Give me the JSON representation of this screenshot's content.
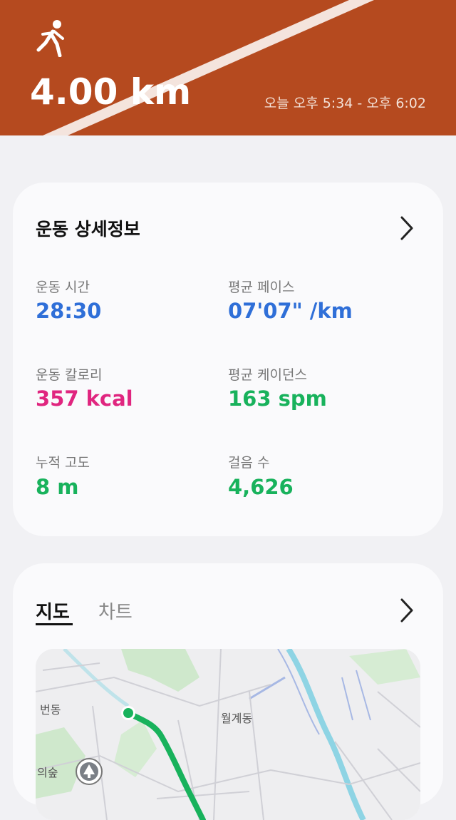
{
  "workout": {
    "distance": "4.00 km",
    "time_range": "오늘 오후 5:34 - 오후 6:02"
  },
  "details": {
    "title": "운동 상세정보",
    "stats": [
      {
        "label": "운동 시간",
        "value": "28:30",
        "color": "#2f6fd8"
      },
      {
        "label": "평균 페이스",
        "value": "07'07\" /km",
        "color": "#2f6fd8"
      },
      {
        "label": "운동 칼로리",
        "value": "357 kcal",
        "color": "#e0257f"
      },
      {
        "label": "평균 케이던스",
        "value": "163 spm",
        "color": "#18b25c"
      },
      {
        "label": "누적 고도",
        "value": "8 m",
        "color": "#18b25c"
      },
      {
        "label": "걸음 수",
        "value": "4,626",
        "color": "#18b25c"
      }
    ]
  },
  "map_section": {
    "tabs": [
      "지도",
      "차트"
    ],
    "map_labels": [
      "번동",
      "월계동",
      "의숲"
    ]
  },
  "colors": {
    "track": "#b54a1f",
    "route": "#18b25c"
  }
}
